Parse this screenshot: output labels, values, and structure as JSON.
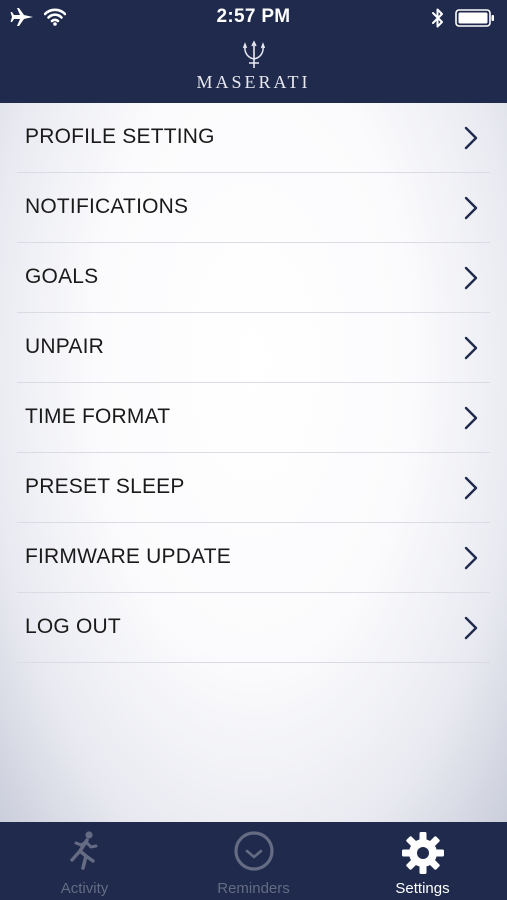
{
  "status_bar": {
    "time": "2:57 PM",
    "icons": [
      "airplane-icon",
      "wifi-icon",
      "bluetooth-icon",
      "battery-icon"
    ]
  },
  "header": {
    "brand_name": "MASERATI",
    "logo": "trident-icon"
  },
  "menu": {
    "items": [
      {
        "label": "PROFILE SETTING"
      },
      {
        "label": "NOTIFICATIONS"
      },
      {
        "label": "GOALS"
      },
      {
        "label": "UNPAIR"
      },
      {
        "label": "TIME FORMAT"
      },
      {
        "label": "PRESET SLEEP"
      },
      {
        "label": "FIRMWARE UPDATE"
      },
      {
        "label": "LOG OUT"
      }
    ]
  },
  "tabbar": {
    "tabs": [
      {
        "label": "Activity",
        "icon": "runner-icon",
        "active": false
      },
      {
        "label": "Reminders",
        "icon": "clock-icon",
        "active": false
      },
      {
        "label": "Settings",
        "icon": "gear-icon",
        "active": true
      }
    ]
  },
  "colors": {
    "navy": "#1f2a4d",
    "chevron": "#1f2a4d",
    "inactive_tab": "#646b82",
    "active_tab": "#ffffff"
  }
}
